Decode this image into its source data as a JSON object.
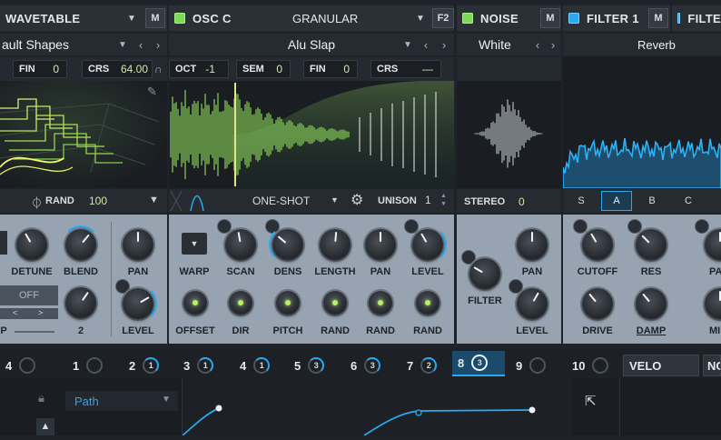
{
  "wavetable": {
    "header_title": "WAVETABLE",
    "m_label": "M",
    "shape_name": "ault Shapes",
    "fin_label": "FIN",
    "fin_value": "0",
    "crs_label": "CRS",
    "crs_value": "64.00",
    "rand_label": "RAND",
    "rand_value": "100",
    "knobs": [
      "DETUNE",
      "BLEND",
      "PAN",
      "LEVEL"
    ],
    "off_label": "OFF",
    "partial_label_p": "P",
    "partial_value": "2"
  },
  "osc_c": {
    "header_title": "OSC C",
    "mode": "GRANULAR",
    "f2_label": "F2",
    "sample_name": "Alu Slap",
    "oct_label": "OCT",
    "oct_value": "-1",
    "sem_label": "SEM",
    "sem_value": "0",
    "fin_label": "FIN",
    "fin_value": "0",
    "crs_label": "CRS",
    "crs_value": "—",
    "play_mode": "ONE-SHOT",
    "unison_label": "UNISON",
    "unison_value": "1",
    "knob_row1": [
      "WARP",
      "SCAN",
      "DENS",
      "LENGTH",
      "PAN",
      "LEVEL"
    ],
    "knob_row2": [
      "OFFSET",
      "DIR",
      "PITCH",
      "RAND",
      "RAND",
      "RAND"
    ]
  },
  "noise": {
    "header_title": "NOISE",
    "m_label": "M",
    "type": "White",
    "stereo_label": "STEREO",
    "stereo_value": "0",
    "knobs": [
      "PAN",
      "FILTER",
      "LEVEL"
    ]
  },
  "filter1": {
    "header_title": "FILTER 1",
    "m_label": "M",
    "type": "Reverb",
    "tabs": [
      "S",
      "A",
      "B",
      "C"
    ],
    "active_tab": "A",
    "knobs": [
      "CUTOFF",
      "RES",
      "DRIVE",
      "DAMP"
    ],
    "partial_labels": [
      "PA",
      "MI"
    ]
  },
  "filter2": {
    "header_title": "FILTE"
  },
  "mod_slots": [
    {
      "num": "4",
      "badge": ""
    },
    {
      "num": "1",
      "badge": ""
    },
    {
      "num": "2",
      "badge": "1"
    },
    {
      "num": "3",
      "badge": "1"
    },
    {
      "num": "4",
      "badge": "1"
    },
    {
      "num": "5",
      "badge": "3"
    },
    {
      "num": "6",
      "badge": "3"
    },
    {
      "num": "7",
      "badge": "2"
    },
    {
      "num": "8",
      "badge": "3"
    },
    {
      "num": "9",
      "badge": ""
    },
    {
      "num": "10",
      "badge": ""
    }
  ],
  "velo_label": "VELO",
  "no_label": "NO",
  "path_label": "Path",
  "colors": {
    "accent_green": "#7ed957",
    "accent_blue": "#29a9ee",
    "knob_panel": "#97a3b0",
    "background": "#1f2329"
  },
  "icons": [
    "pencil-icon",
    "phase-icon",
    "chevron-down-icon",
    "chevron-left-icon",
    "chevron-right-icon",
    "gear-icon",
    "lock-icon",
    "chevron-up-icon",
    "export-icon",
    "unison-stepper-icon"
  ]
}
